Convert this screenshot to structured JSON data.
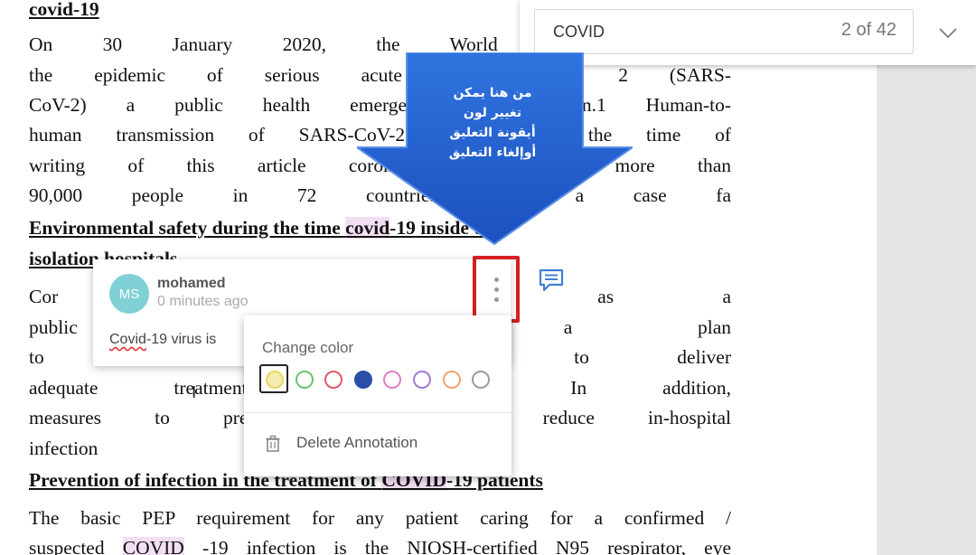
{
  "document": {
    "lines": [
      {
        "segments": [
          {
            "t": "covid-19",
            "hl": false
          }
        ],
        "heading": true
      },
      {
        "segments": [
          {
            "t": "On 30 January 2020, the World Health Organizati",
            "hl": false
          }
        ]
      },
      {
        "segments": [
          {
            "t": "the epidemic of serious acute respirato",
            "hl": false
          },
          {
            "t": "rus 2 (SARS-",
            "hl": false
          }
        ]
      },
      {
        "segments": [
          {
            "t": "CoV-2) a public health emergency of i",
            "hl": false
          },
          {
            "t": "rn.1 Human-to-",
            "hl": false
          }
        ]
      },
      {
        "segments": [
          {
            "t": "human transmission of SARS-CoV-2 wa",
            "hl": false
          },
          {
            "t": "d at the time of",
            "hl": false
          }
        ]
      },
      {
        "segments": [
          {
            "t": "writing of this article coronavirus dise",
            "hl": false
          },
          {
            "t": "in more than",
            "hl": false
          }
        ]
      },
      {
        "segments": [
          {
            "t": "90,000 people in 72 countries, with a case fa",
            "hl": false
          }
        ]
      },
      {
        "segments": [
          {
            "t": "Environmental safety during the time ",
            "hl": false
          },
          {
            "t": "covid",
            "hl": true
          },
          {
            "t": "-19 inside the",
            "hl": false
          }
        ],
        "heading": true
      },
      {
        "segments": [
          {
            "t": "isolation hospitals",
            "hl": false
          }
        ],
        "heading": true
      },
      {
        "segments": [
          {
            "t": "Cor",
            "hl": false
          },
          {
            "t": "has been listed as a",
            "hl": false
          }
        ]
      },
      {
        "segments": [
          {
            "t": "public",
            "hl": false
          },
          {
            "t": "Hospitals need a plan",
            "hl": false
          }
        ]
      },
      {
        "segments": [
          {
            "t": "to con",
            "hl": false
          },
          {
            "t": "t in order to deliver",
            "hl": false
          }
        ]
      },
      {
        "segments": [
          {
            "t": "adequate treatment to",
            "hl": false
          },
          {
            "t": "pandemic. In addition,",
            "hl": false
          }
        ]
      },
      {
        "segments": [
          {
            "t": "measures to prevent in",
            "hl": false
          },
          {
            "t": "ce to reduce in-hospital",
            "hl": false
          }
        ]
      },
      {
        "segments": [
          {
            "t": "infection",
            "hl": false
          }
        ],
        "last": true
      },
      {
        "segments": [
          {
            "t": "Prevention of infection in the treatment of ",
            "hl": false
          },
          {
            "t": "COVID",
            "hl": true
          },
          {
            "t": "-19 patients",
            "hl": false
          }
        ],
        "heading": true
      },
      {
        "segments": [
          {
            "t": "The basic PEP requirement for any patient caring for a confirmed /",
            "hl": false
          }
        ]
      },
      {
        "segments": [
          {
            "t": "suspected ",
            "hl": false
          },
          {
            "t": "COVID",
            "hl": true
          },
          {
            "t": "-19 infection is the NIOSH-certified N95 respirator, eye",
            "hl": false
          }
        ]
      }
    ]
  },
  "search": {
    "query": "COVID",
    "match_count": "2 of 42"
  },
  "callout": {
    "lines": [
      "من هنا يمكن",
      "تغيير لون",
      "أيقونة التعليق",
      "أوإلغاء التعليق"
    ],
    "color": "#1f5fcf"
  },
  "annotation": {
    "avatar_initials": "MS",
    "author": "mohamed",
    "timestamp": "0 minutes ago",
    "comment_prefix": "Covid",
    "comment_rest": "-19 virus is"
  },
  "color_menu": {
    "label": "Change color",
    "swatches": [
      {
        "name": "yellow",
        "color": "#e8d85e",
        "fill": false,
        "selected": true
      },
      {
        "name": "green",
        "color": "#6cc36c",
        "fill": false
      },
      {
        "name": "red",
        "color": "#e0596a",
        "fill": false
      },
      {
        "name": "blue",
        "color": "#2a4fa8",
        "fill": true
      },
      {
        "name": "pink",
        "color": "#de7fc2",
        "fill": false
      },
      {
        "name": "purple",
        "color": "#a37ad6",
        "fill": false
      },
      {
        "name": "orange",
        "color": "#f0a36c",
        "fill": false
      },
      {
        "name": "gray",
        "color": "#9c9c9c",
        "fill": false
      }
    ],
    "delete_label": "Delete Annotation"
  },
  "icons": {
    "search_chevron": "chevron-down-icon",
    "note": "comment-icon",
    "trash": "trash-icon",
    "more": "more-vertical-icon"
  }
}
